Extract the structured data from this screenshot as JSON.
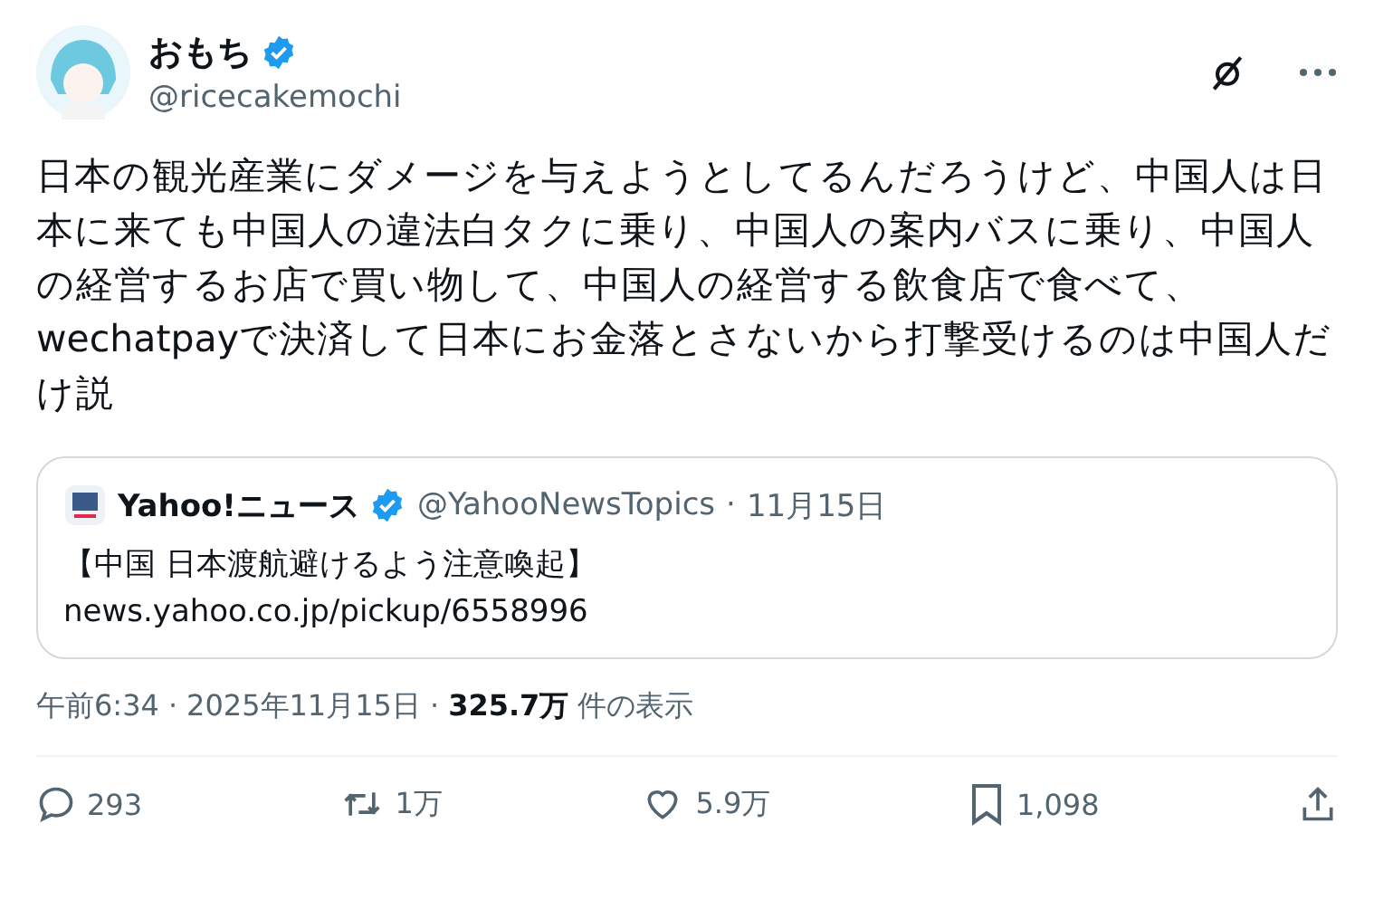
{
  "author": {
    "name": "おもち",
    "verified": true,
    "handle": "@ricecakemochi"
  },
  "body": "日本の観光産業にダメージを与えようとしてるんだろうけど、中国人は日本に来ても中国人の違法白タクに乗り、中国人の案内バスに乗り、中国人の経営するお店で買い物して、中国人の経営する飲食店で食べて、wechatpayで決済して日本にお金落とさないから打撃受けるのは中国人だけ説",
  "quote": {
    "name": "Yahoo!ニュース",
    "verified": true,
    "handle": "@YahooNewsTopics",
    "separator": "·",
    "date": "11月15日",
    "title": "【中国 日本渡航避けるよう注意喚起】",
    "link": "news.yahoo.co.jp/pickup/6558996"
  },
  "meta": {
    "time": "午前6:34",
    "separator_1": "·",
    "date": "2025年11月15日",
    "separator_2": "·",
    "views": "325.7万",
    "views_label": "件の表示"
  },
  "actions": [
    {
      "kind": "reply",
      "count": "293"
    },
    {
      "kind": "repost",
      "count": "1万"
    },
    {
      "kind": "like",
      "count": "5.9万"
    },
    {
      "kind": "bookmark",
      "count": "1,098"
    },
    {
      "kind": "share"
    }
  ]
}
